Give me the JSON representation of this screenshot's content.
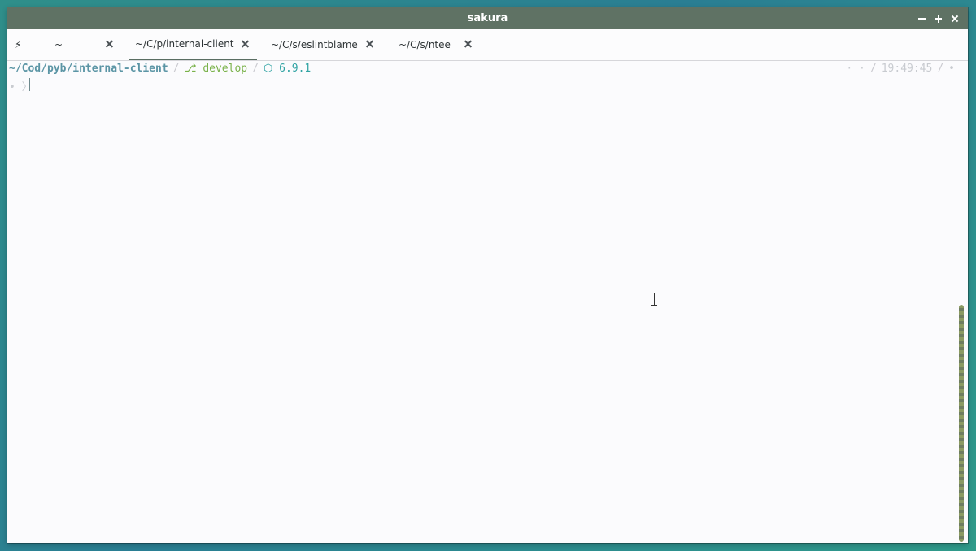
{
  "window": {
    "title": "sakura"
  },
  "tabs": [
    {
      "label": "⚡",
      "active": false
    },
    {
      "label": "~",
      "active": false
    },
    {
      "label": "~/C/p/internal-client",
      "active": true
    },
    {
      "label": "~/C/s/eslintblame",
      "active": false
    },
    {
      "label": "~/C/s/ntee",
      "active": false
    }
  ],
  "terminal": {
    "cwd": "~/Cod/pyb/internal-client",
    "separator": "/",
    "branch_symbol": "⎇",
    "branch": "develop",
    "node_symbol": "⬡",
    "node_version": "6.9.1",
    "right_prompt": {
      "dots": "· ·",
      "time": "19:49:45",
      "marker": "•"
    },
    "prompt_symbol": "• 〉"
  },
  "colors": {
    "titlebar": "#5f7264",
    "cwd": "#5b95a5",
    "branch": "#7ab24a",
    "node": "#2fa3a3",
    "scrollbar": "#8b9a62"
  }
}
